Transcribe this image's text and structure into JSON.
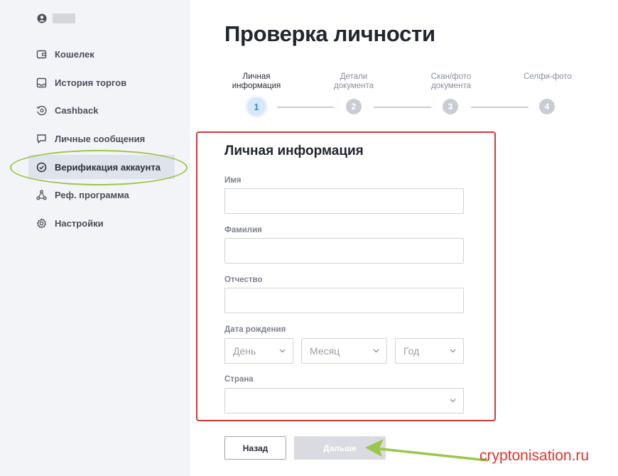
{
  "sidebar": {
    "items": [
      {
        "label": "Кошелек",
        "icon": "wallet-icon"
      },
      {
        "label": "История торгов",
        "icon": "inbox-icon"
      },
      {
        "label": "Cashback",
        "icon": "cashback-icon"
      },
      {
        "label": "Личные сообщения",
        "icon": "message-icon"
      },
      {
        "label": "Верификация аккаунта",
        "icon": "check-circle-icon",
        "active": true
      },
      {
        "label": "Реф. программа",
        "icon": "referral-icon"
      },
      {
        "label": "Настройки",
        "icon": "gear-icon"
      }
    ]
  },
  "page": {
    "title": "Проверка личности"
  },
  "stepper": {
    "steps": [
      {
        "line1": "Личная",
        "line2": "информация",
        "number": "1",
        "active": true
      },
      {
        "line1": "Детали",
        "line2": "документа",
        "number": "2"
      },
      {
        "line1": "Скан/фото",
        "line2": "документа",
        "number": "3"
      },
      {
        "line1": "Селфи-фото",
        "line2": "",
        "number": "4"
      }
    ]
  },
  "form": {
    "title": "Личная информация",
    "first_name_label": "Имя",
    "first_name_value": "",
    "last_name_label": "Фамилия",
    "last_name_value": "",
    "patronymic_label": "Отчество",
    "patronymic_value": "",
    "birthdate_label": "Дата рождения",
    "day_placeholder": "День",
    "month_placeholder": "Месяц",
    "year_placeholder": "Год",
    "country_label": "Страна",
    "country_value": ""
  },
  "buttons": {
    "back_label": "Назад",
    "next_label": "Дальше"
  },
  "watermark": "cryptonisation.ru",
  "colors": {
    "annotation_red": "#d0393b",
    "annotation_green": "#9cc64a",
    "active_step": "#3b8ee0"
  }
}
